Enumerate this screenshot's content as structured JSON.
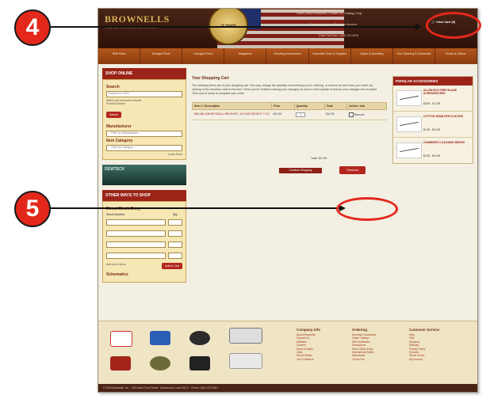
{
  "callouts": {
    "a": "4",
    "b": "5"
  },
  "colors": {
    "accent": "#e3281b",
    "header": "#3a170c",
    "nav": "#a64c17"
  },
  "site": {
    "logo": "BROWNELLS",
    "tagline": "SINCE 1939 — GUNSMITH & SHOOTER SUPPLY",
    "top_links": "Home | About Brownells | Contact Us | Catalog | Help",
    "welcome": "Welcome | Login or Create an Account",
    "toll_free": "Order Toll Free: 1-800-741-0015",
    "cart_link": "View Cart (0)",
    "seal_text": "70 YEARS"
  },
  "nav": [
    "Rifle Parts",
    "Shotgun Parts",
    "Handgun Parts",
    "Magazines",
    "Shooting Accessories",
    "Gunsmith Tools & Supplies",
    "Optics & Mounting",
    "Gun Cleaning & Chemicals",
    "Books & Videos"
  ],
  "left": {
    "shop_online": "SHOP ONLINE",
    "search_label": "Search",
    "search_placeholder": "Keyword or SKU",
    "search_option_1": "Within current search results",
    "search_option_2": "Product Search",
    "search_btn": "Search",
    "manufacturer_label": "Manufacturer",
    "manufacturer_value": "-- Filter by Manufacturer --",
    "category_label": "Item Category",
    "category_value": "-- Filter by Category --",
    "learn_more": "Learn More",
    "ad": "DEWTECK",
    "other_ways": "OTHER WAYS TO SHOP",
    "direct_stock": "Direct Stock Entry",
    "stock_number": "Stock Number",
    "qty": "Qty",
    "add_more": "Add more items",
    "add_to_cart": "Add to Cart",
    "schematics": "Schematics"
  },
  "main": {
    "title": "Your Shopping Cart",
    "intro": "The following items are in your shopping cart. You may change the quantity of something you're ordering, or remove an item from your order, by clicking in the checkbox next to the item. When you've finished making your changes, be sure to click Update to ensure your changes are recorded. Then you're ready to complete your order.",
    "columns": [
      "Item # / Description",
      "Price",
      "Quantity",
      "Total",
      "Action / Info"
    ],
    "row": {
      "desc": "080-666-408 BR SMALL BRUSHES, 1/4 SIZE WEIGHT 2 OZ",
      "price": "$11.99",
      "qty": "1",
      "total": "$11.99",
      "action": "Remove"
    },
    "total_label": "Total:",
    "total_value": "$11.99",
    "continue_btn": "Continue Shopping",
    "checkout_btn": "Checkout"
  },
  "right": {
    "title": "POPULAR ACCESSORIES",
    "items": [
      {
        "name": "ALLEN BOX FREE BLADE SCREWDRIVERS",
        "price": "$8.95 - $13.99"
      },
      {
        "name": "COTTON SWAB APPLICATORS",
        "price": "$1.99 - $13.99"
      },
      {
        "name": "CHAMBER'S CLEANING BRUSH",
        "price": "$2.99 - $10.99"
      }
    ]
  },
  "footer": {
    "company_title": "Company Info",
    "company_links": [
      "About Brownells",
      "Contact Us",
      "Affiliates",
      "Careers",
      "News & Radio",
      "Links",
      "Shoot Harder",
      "List of Builders"
    ],
    "ordering_title": "Ordering",
    "ordering_links": [
      "Domestic Guarantee",
      "Order Catalog",
      "Gift Certificates",
      "Exemptions",
      "Direct Stock Entry",
      "International Sales",
      "Nationwide",
      "Check Out"
    ],
    "service_title": "Customer Service",
    "service_links": [
      "Help",
      "FAQ",
      "Shipping",
      "Sitemap",
      "Privacy Policy",
      "Security",
      "Terms of Use",
      "My Account"
    ],
    "bottom": "© 2009 Brownells, Inc. · 200 South Front Street · Montezuma, Iowa 50171 · Phone: (641) 623-5401"
  }
}
